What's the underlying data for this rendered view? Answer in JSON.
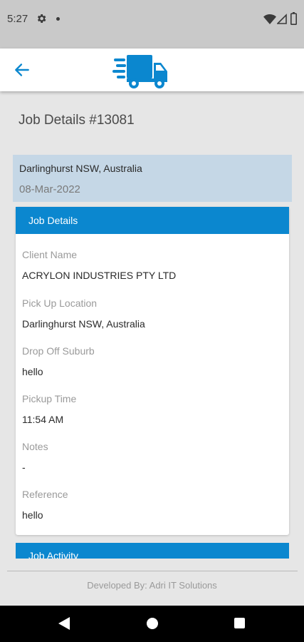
{
  "status_bar": {
    "time": "5:27",
    "icons": [
      "gear-icon",
      "notification-dot-icon",
      "wifi-icon",
      "signal-icon",
      "battery-icon"
    ]
  },
  "app_bar": {
    "back_icon": "arrow-left-icon",
    "logo_icon": "delivery-truck-icon",
    "accent_color": "#0b87cf"
  },
  "page": {
    "title": "Job Details #13081"
  },
  "location_header": {
    "address": "Darlinghurst NSW, Australia",
    "date": "08-Mar-2022"
  },
  "job_details": {
    "header": "Job Details",
    "fields": [
      {
        "label": "Client Name",
        "value": "ACRYLON INDUSTRIES PTY LTD"
      },
      {
        "label": "Pick Up Location",
        "value": "Darlinghurst NSW, Australia"
      },
      {
        "label": "Drop Off Suburb",
        "value": "hello"
      },
      {
        "label": "Pickup Time",
        "value": "11:54 AM"
      },
      {
        "label": "Notes",
        "value": "-"
      },
      {
        "label": "Reference",
        "value": "hello"
      }
    ]
  },
  "job_activity": {
    "header": "Job Activity"
  },
  "footer": {
    "text": "Developed By: Adri IT Solutions"
  },
  "nav_bar": {
    "icons": [
      "nav-back-icon",
      "nav-home-icon",
      "nav-recents-icon"
    ]
  }
}
